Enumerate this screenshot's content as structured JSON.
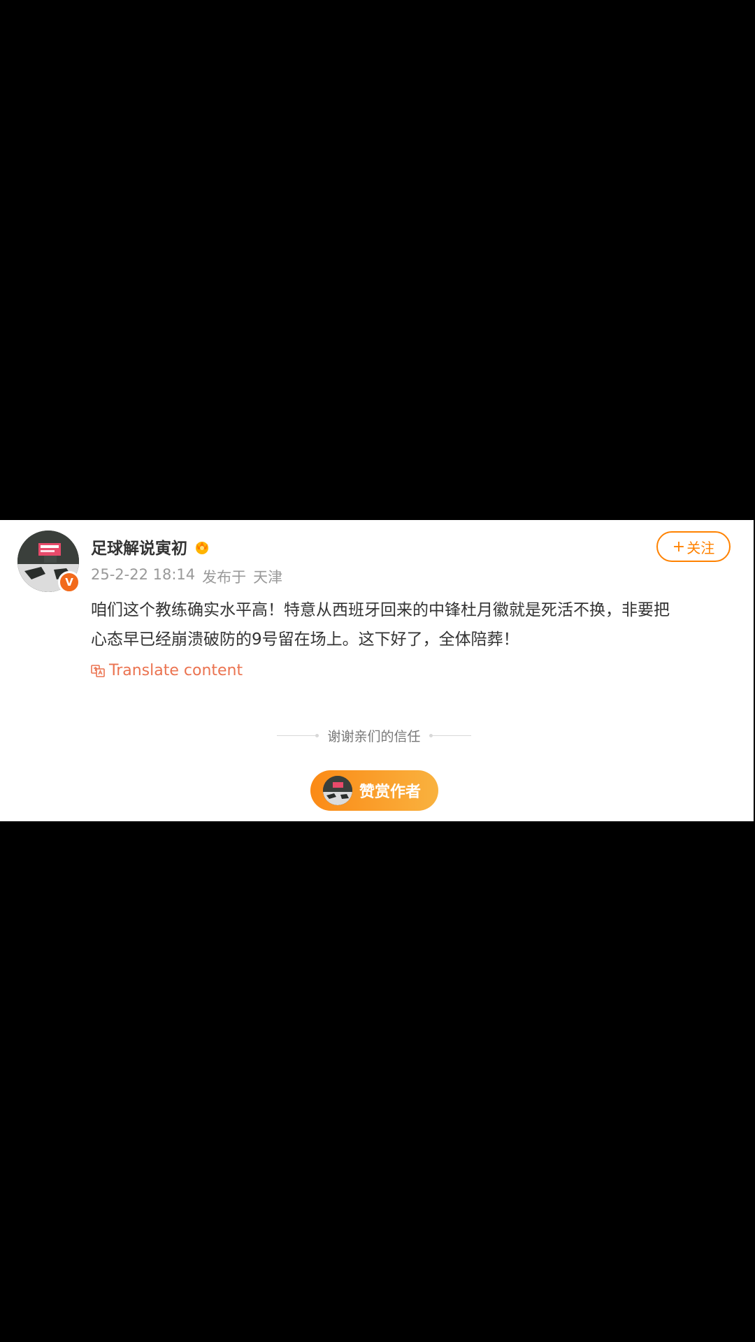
{
  "post": {
    "author": {
      "name": "足球解说寅初",
      "verified_badge": "V"
    },
    "timestamp": "25-2-22 18:14",
    "published_at_label": "发布于",
    "location": "天津",
    "follow_button": {
      "plus": "+",
      "label": "关注"
    },
    "content_line1": "咱们这个教练确实水平高！特意从西班牙回来的中锋杜月徽就是死活不换，非要把",
    "content_line2": "心态早已经崩溃破防的9号留在场上。这下好了，全体陪葬！",
    "translate_label": "Translate content"
  },
  "reward": {
    "thanks_text": "谢谢亲们的信任",
    "button_label": "赞赏作者"
  },
  "colors": {
    "accent_orange": "#ff8200",
    "translate_red": "#eb7350",
    "verified_orange": "#f26a1b"
  },
  "icons": {
    "vip": "crown-vip-icon",
    "translate": "translate-icon"
  }
}
